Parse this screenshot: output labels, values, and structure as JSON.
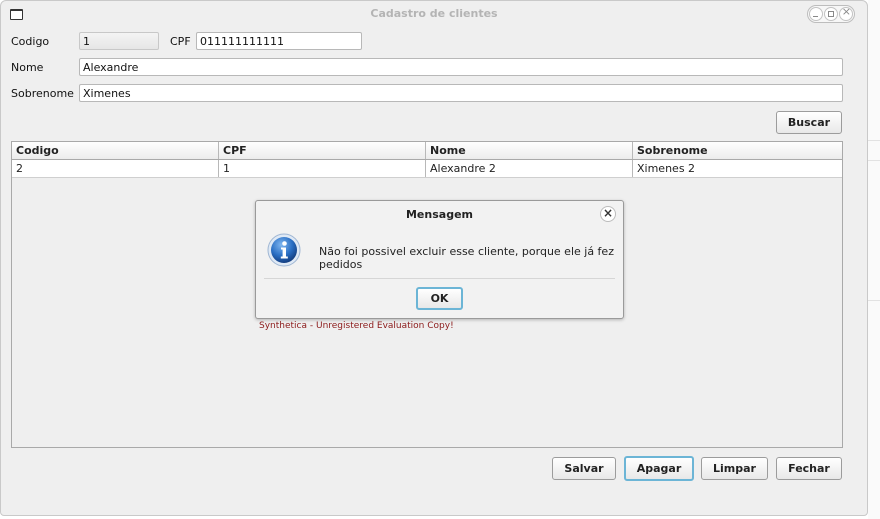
{
  "window": {
    "title": "Cadastro de clientes"
  },
  "form": {
    "codigo_label": "Codigo",
    "codigo_value": "1",
    "cpf_label": "CPF",
    "cpf_value": "011111111111",
    "nome_label": "Nome",
    "nome_value": "Alexandre",
    "sobrenome_label": "Sobrenome",
    "sobrenome_value": "Ximenes",
    "buscar_label": "Buscar"
  },
  "table": {
    "columns": [
      "Codigo",
      "CPF",
      "Nome",
      "Sobrenome"
    ],
    "rows": [
      [
        "2",
        "1",
        "Alexandre 2",
        "Ximenes 2"
      ]
    ]
  },
  "dialog": {
    "title": "Mensagem",
    "close_glyph": "×",
    "message": "Não foi possivel excluir esse cliente, porque ele já fez pedidos",
    "ok_label": "OK",
    "icon": "info-icon"
  },
  "watermark": "Synthetica - Unregistered Evaluation Copy!",
  "buttons": {
    "salvar": "Salvar",
    "apagar": "Apagar",
    "limpar": "Limpar",
    "fechar": "Fechar"
  },
  "colors": {
    "focus_border": "#6cb5d6",
    "info_icon": "#1f5fae",
    "watermark": "#8b1a1a"
  }
}
